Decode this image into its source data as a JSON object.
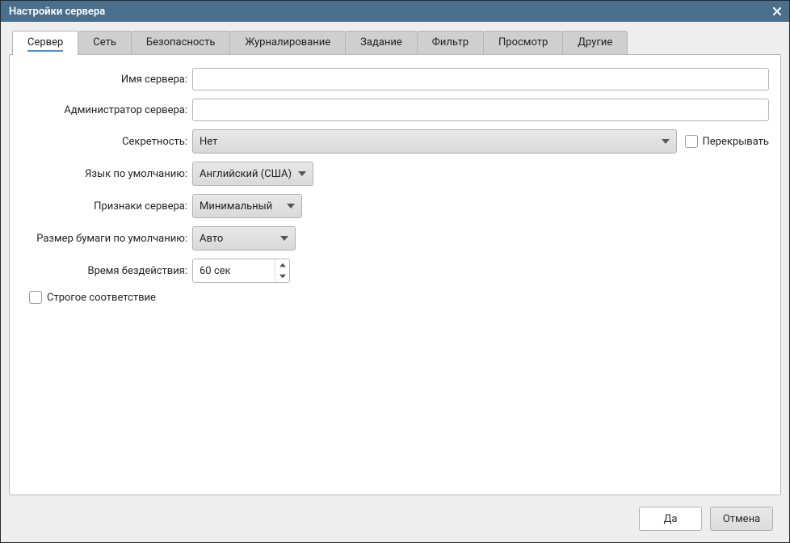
{
  "window": {
    "title": "Настройки сервера"
  },
  "tabs": [
    {
      "label": "Сервер",
      "active": true
    },
    {
      "label": "Сеть",
      "active": false
    },
    {
      "label": "Безопасность",
      "active": false
    },
    {
      "label": "Журналирование",
      "active": false
    },
    {
      "label": "Задание",
      "active": false
    },
    {
      "label": "Фильтр",
      "active": false
    },
    {
      "label": "Просмотр",
      "active": false
    },
    {
      "label": "Другие",
      "active": false
    }
  ],
  "form": {
    "server_name": {
      "label": "Имя сервера:",
      "value": ""
    },
    "server_admin": {
      "label": "Администратор сервера:",
      "value": ""
    },
    "secrecy": {
      "label": "Секретность:",
      "value": "Нет"
    },
    "overlay_checkbox": {
      "label": "Перекрывать"
    },
    "default_language": {
      "label": "Язык по умолчанию:",
      "value": "Английский (США)"
    },
    "server_traits": {
      "label": "Признаки сервера:",
      "value": "Минимальный"
    },
    "default_paper_size": {
      "label": "Размер бумаги по умолчанию:",
      "value": "Авто"
    },
    "idle_time": {
      "label": "Время бездействия:",
      "value": "60 сек"
    },
    "strict_match": {
      "label": "Строгое соответствие"
    }
  },
  "buttons": {
    "ok": "Да",
    "cancel": "Отмена"
  }
}
